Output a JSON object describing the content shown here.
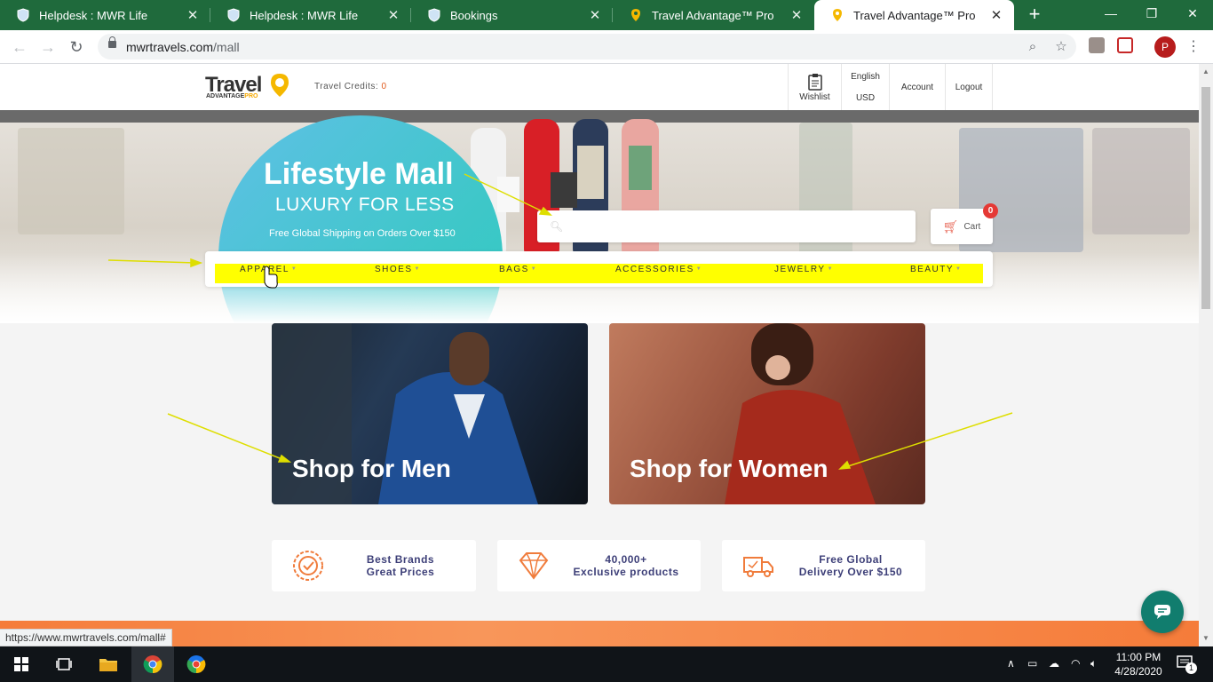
{
  "browser": {
    "tabs": [
      {
        "title": "Helpdesk : MWR Life",
        "icon": "shield-icon",
        "active": false
      },
      {
        "title": "Helpdesk : MWR Life",
        "icon": "shield-icon",
        "active": false
      },
      {
        "title": "Bookings",
        "icon": "shield-icon",
        "active": false
      },
      {
        "title": "Travel Advantage™ Pro",
        "icon": "location-pin-icon",
        "active": false
      },
      {
        "title": "Travel Advantage™ Pro",
        "icon": "location-pin-icon",
        "active": true
      }
    ],
    "url_host": "mwrtravels.com",
    "url_path": "/mall",
    "profile_initial": "P",
    "status_url": "https://www.mwrtravels.com/mall#"
  },
  "site": {
    "logo_main": "Travel",
    "logo_sub": "ADVANTAGE",
    "logo_pro": "PRO",
    "credits_label": "Travel Credits:",
    "credits_value": "0",
    "wishlist": "Wishlist",
    "language": "English",
    "currency": "USD",
    "account": "Account",
    "logout": "Logout"
  },
  "hero": {
    "title": "Lifestyle Mall",
    "subtitle": "LUXURY FOR LESS",
    "shipping": "Free Global Shipping on Orders Over $150",
    "search_placeholder": "",
    "cart_label": "Cart",
    "cart_count": "0"
  },
  "categories": [
    "APPAREL",
    "SHOES",
    "BAGS",
    "ACCESSORIES",
    "JEWELRY",
    "BEAUTY"
  ],
  "shop": {
    "men": "Shop for Men",
    "women": "Shop for Women"
  },
  "features": [
    {
      "line1": "Best Brands",
      "line2": "Great Prices",
      "icon": "badge-check-icon"
    },
    {
      "line1": "40,000+",
      "line2": "Exclusive products",
      "icon": "diamond-icon"
    },
    {
      "line1": "Free Global",
      "line2": "Delivery Over $150",
      "icon": "delivery-truck-icon"
    }
  ],
  "taskbar": {
    "time": "11:00 PM",
    "date": "4/28/2020",
    "notifications": "1"
  },
  "colors": {
    "chrome_tab_bg": "#1f6a3c",
    "accent_teal": "#3fc7c9",
    "accent_orange": "#f57c3a",
    "highlight_yellow": "#ffff00",
    "feature_text": "#3d3f78"
  }
}
